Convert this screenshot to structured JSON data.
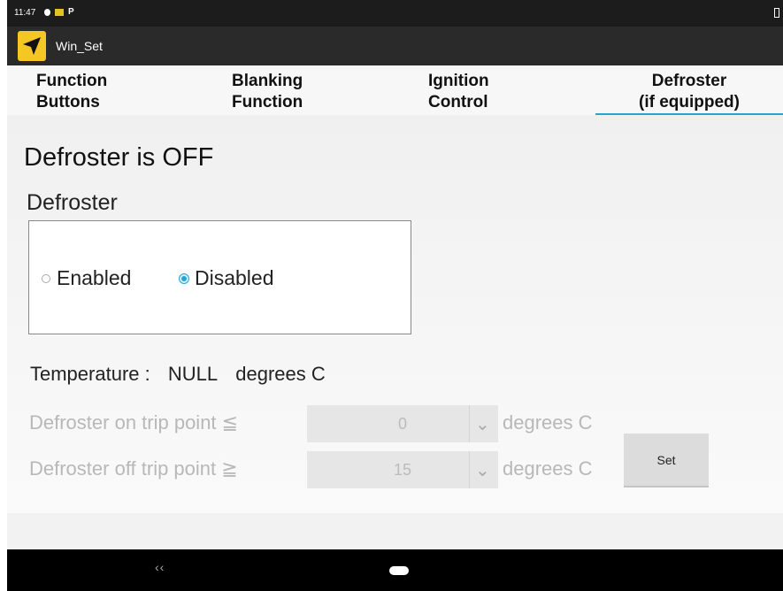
{
  "status_bar": {
    "time": "11:47",
    "notif_p": "P"
  },
  "app": {
    "title": "Win_Set",
    "icon": "navigation-arrow-icon"
  },
  "tabs": [
    {
      "line1": "Function",
      "line2": "Buttons"
    },
    {
      "line1": "Blanking",
      "line2": "Function"
    },
    {
      "line1": "Ignition",
      "line2": "Control"
    },
    {
      "line1": "Defroster",
      "line2": "(if equipped)"
    }
  ],
  "active_tab": 3,
  "main": {
    "status_title": "Defroster is OFF",
    "section_label": "Defroster",
    "radio_enabled": "Enabled",
    "radio_disabled": "Disabled",
    "selected": "Disabled",
    "temperature_label": "Temperature :",
    "temperature_value": "NULL",
    "temperature_unit": "degrees C",
    "on_trip_label": "Defroster on trip point ≦",
    "on_trip_value": "0",
    "on_trip_unit": "degrees C",
    "off_trip_label": "Defroster off trip point ≧",
    "off_trip_value": "15",
    "off_trip_unit": "degrees C",
    "set_label": "Set"
  },
  "colors": {
    "accent": "#29a3d6",
    "app_icon": "#f4c724"
  },
  "nav": {
    "back": "‹‹"
  }
}
